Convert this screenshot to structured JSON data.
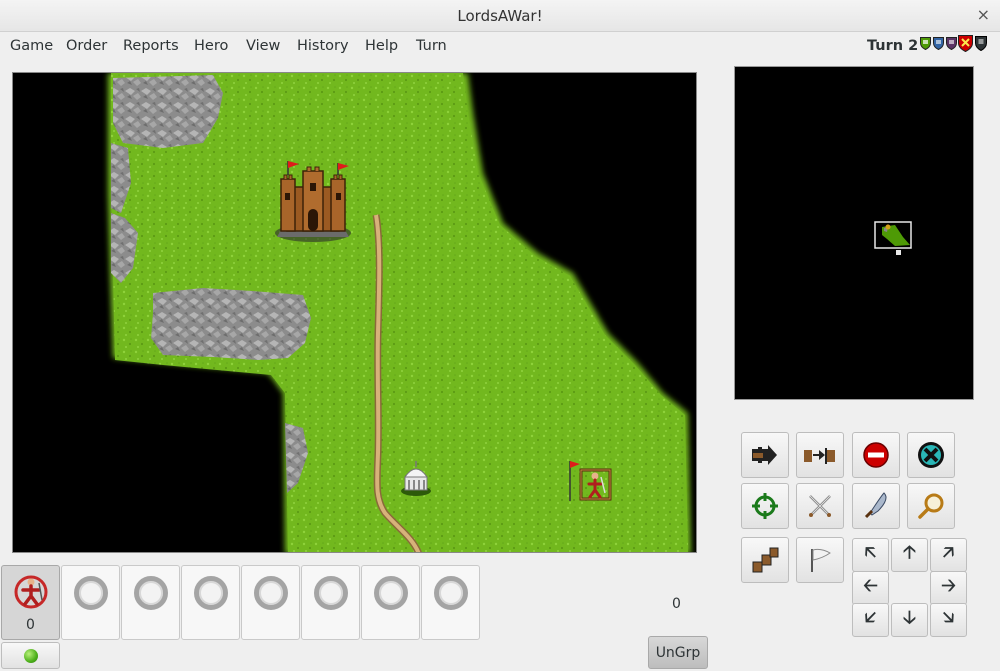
{
  "window": {
    "title": "LordsAWar!",
    "close_glyph": "×"
  },
  "menu": [
    "Game",
    "Order",
    "Reports",
    "Hero",
    "View",
    "History",
    "Help",
    "Turn"
  ],
  "turn": {
    "label": "Turn 2"
  },
  "player_shields": [
    {
      "color": "#4e9a06",
      "name": "green-player-shield-icon"
    },
    {
      "color": "#3465a4",
      "name": "blue-player-shield-icon"
    },
    {
      "color": "#5c3566",
      "name": "purple-player-shield-icon"
    },
    {
      "color": "#cc0000",
      "name": "red-player-shield-icon"
    },
    {
      "color": "#2e3436",
      "name": "black-player-shield-icon"
    }
  ],
  "army_slots": [
    {
      "filled": true,
      "count": "0"
    },
    {
      "filled": false,
      "count": ""
    },
    {
      "filled": false,
      "count": ""
    },
    {
      "filled": false,
      "count": ""
    },
    {
      "filled": false,
      "count": ""
    },
    {
      "filled": false,
      "count": ""
    },
    {
      "filled": false,
      "count": ""
    },
    {
      "filled": false,
      "count": ""
    }
  ],
  "stack_moves": "0",
  "ungroup_label": "UnGrp",
  "command_buttons": [
    "next-army-icon",
    "next-army-group-icon",
    "defend-icon",
    "end-turn-icon",
    "center-selected-icon",
    "fight-icon",
    "search-icon",
    "magnify-icon",
    "move-all-icon",
    "surrender-flag-icon"
  ],
  "arrow_buttons": [
    {
      "name": "move-northwest-icon",
      "glyph": "🡤"
    },
    {
      "name": "move-north-icon",
      "glyph": "🡡"
    },
    {
      "name": "move-northeast-icon",
      "glyph": "🡥"
    },
    {
      "name": "move-west-icon",
      "glyph": "🡠"
    },
    {
      "name": "move-east-icon",
      "glyph": "🡢"
    },
    {
      "name": "move-southwest-icon",
      "glyph": "🡧"
    },
    {
      "name": "move-south-icon",
      "glyph": "🡣"
    },
    {
      "name": "move-southeast-icon",
      "glyph": "🡦"
    }
  ],
  "colors": {
    "grass": "#6fb81f",
    "grass_dark": "#4f8c12",
    "rock": "#8a8a8a",
    "road": "#c8a46a",
    "void": "#000000"
  }
}
